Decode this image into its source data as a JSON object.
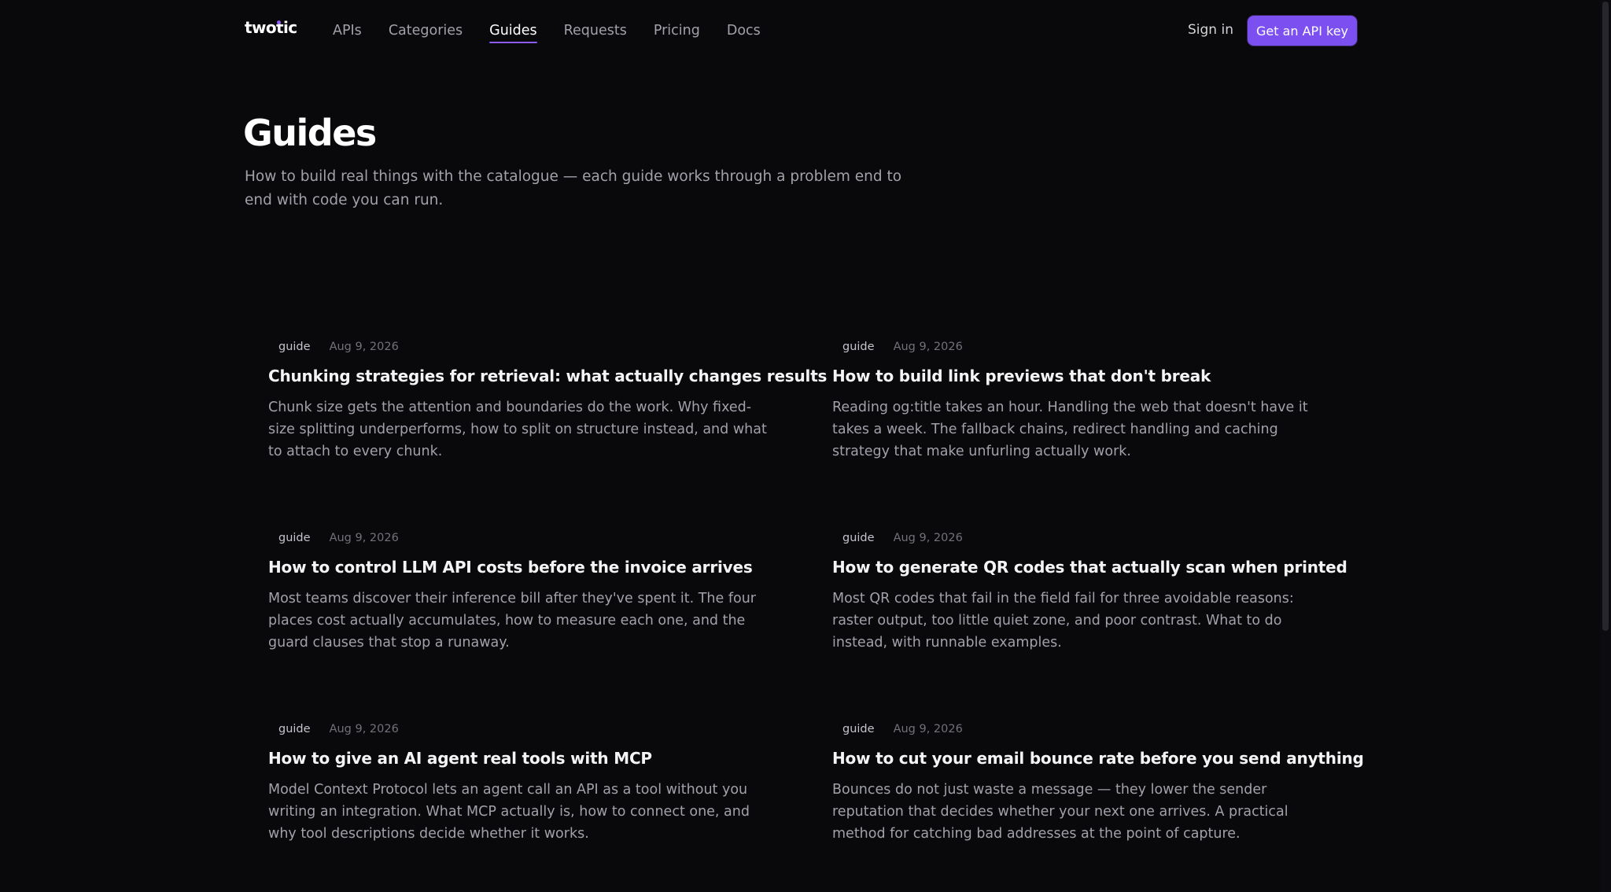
{
  "header": {
    "logo": "twotic",
    "nav": [
      {
        "label": "APIs",
        "active": false
      },
      {
        "label": "Categories",
        "active": false
      },
      {
        "label": "Guides",
        "active": true
      },
      {
        "label": "Requests",
        "active": false
      },
      {
        "label": "Pricing",
        "active": false
      },
      {
        "label": "Docs",
        "active": false
      }
    ],
    "sign_in": "Sign in",
    "cta": "Get an API key"
  },
  "hero": {
    "title": "Guides",
    "subtitle": "How to build real things with the catalogue — each guide works through a problem end to end with code you can run."
  },
  "guides": [
    {
      "tag": "guide",
      "date": "Aug 9, 2026",
      "title": "Chunking strategies for retrieval: what actually changes results",
      "description": "Chunk size gets the attention and boundaries do the work. Why fixed-size splitting underperforms, how to split on structure instead, and what to attach to every chunk."
    },
    {
      "tag": "guide",
      "date": "Aug 9, 2026",
      "title": "How to build link previews that don't break",
      "description": "Reading og:title takes an hour. Handling the web that doesn't have it takes a week. The fallback chains, redirect handling and caching strategy that make unfurling actually work."
    },
    {
      "tag": "guide",
      "date": "Aug 9, 2026",
      "title": "How to control LLM API costs before the invoice arrives",
      "description": "Most teams discover their inference bill after they've spent it. The four places cost actually accumulates, how to measure each one, and the guard clauses that stop a runaway."
    },
    {
      "tag": "guide",
      "date": "Aug 9, 2026",
      "title": "How to generate QR codes that actually scan when printed",
      "description": "Most QR codes that fail in the field fail for three avoidable reasons: raster output, too little quiet zone, and poor contrast. What to do instead, with runnable examples."
    },
    {
      "tag": "guide",
      "date": "Aug 9, 2026",
      "title": "How to give an AI agent real tools with MCP",
      "description": "Model Context Protocol lets an agent call an API as a tool without you writing an integration. What MCP actually is, how to connect one, and why tool descriptions decide whether it works."
    },
    {
      "tag": "guide",
      "date": "Aug 9, 2026",
      "title": "How to cut your email bounce rate before you send anything",
      "description": "Bounces do not just waste a message — they lower the sender reputation that decides whether your next one arrives. A practical method for catching bad addresses at the point of capture."
    }
  ],
  "colors": {
    "background": "#09090c",
    "accent": "#8b5cf6",
    "cta": "#7c4ff0"
  }
}
